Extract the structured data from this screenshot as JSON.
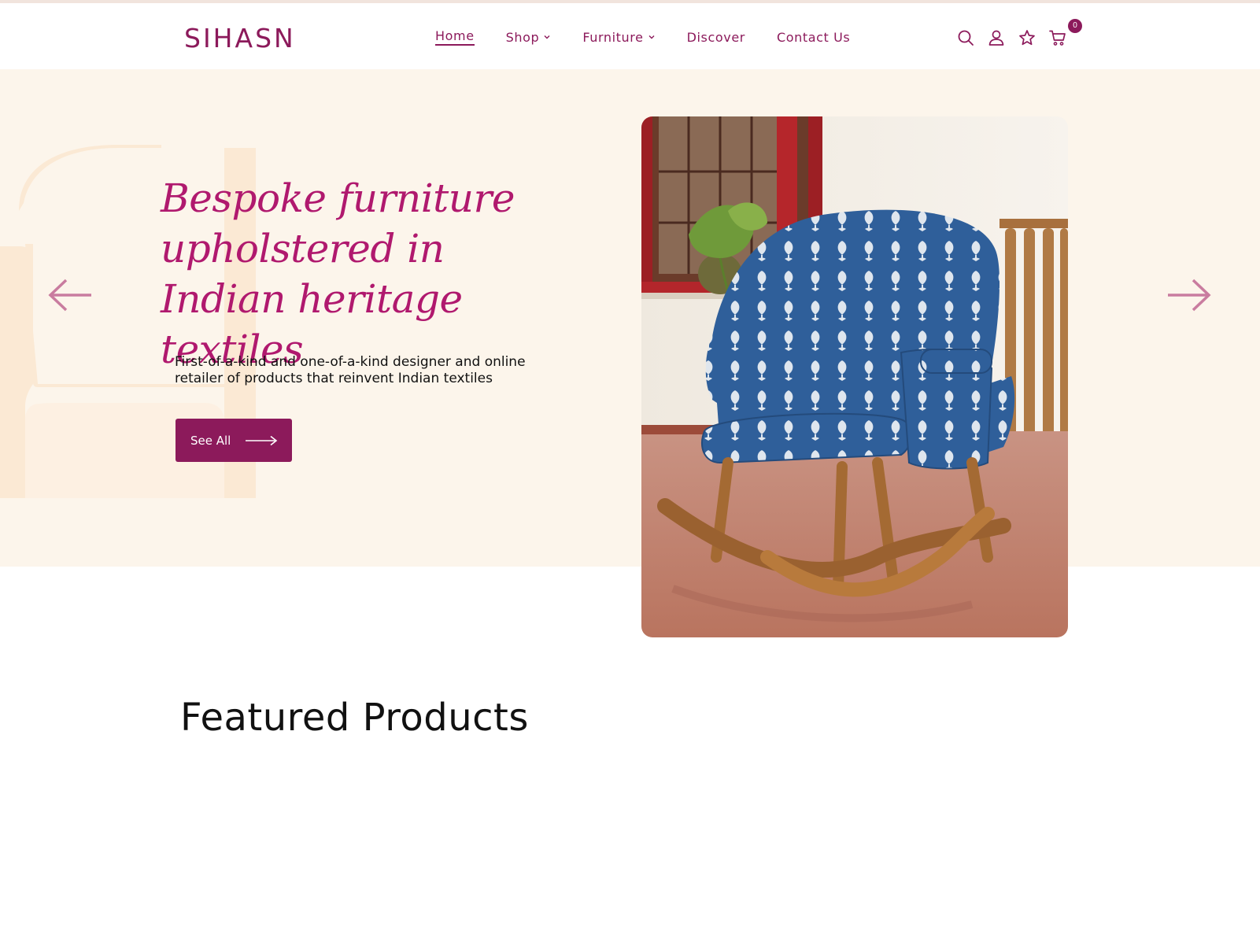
{
  "header": {
    "logo_text": "SIHASN",
    "nav": [
      {
        "label": "Home",
        "active": true,
        "has_dropdown": false
      },
      {
        "label": "Shop",
        "active": false,
        "has_dropdown": true
      },
      {
        "label": "Furniture",
        "active": false,
        "has_dropdown": true
      },
      {
        "label": "Discover",
        "active": false,
        "has_dropdown": false
      },
      {
        "label": "Contact Us",
        "active": false,
        "has_dropdown": false
      }
    ],
    "icons": [
      "search-icon",
      "user-icon",
      "wishlist-star-icon",
      "cart-icon"
    ],
    "cart_count": "0"
  },
  "hero": {
    "title": "Bespoke furniture upholstered in Indian heritage textiles",
    "subtitle": "First-of-a-kind and one-of-a-kind designer and online retailer of products that reinvent Indian textiles",
    "cta_label": "See All",
    "prev_icon": "arrow-left-icon",
    "next_icon": "arrow-right-icon"
  },
  "featured": {
    "title": "Featured Products"
  },
  "colors": {
    "brand": "#8c1a5b",
    "accent_script": "#b0196e",
    "hero_bg": "#fcf5eb",
    "deco": "#fbe9d4",
    "arrow": "#c97c9f"
  }
}
